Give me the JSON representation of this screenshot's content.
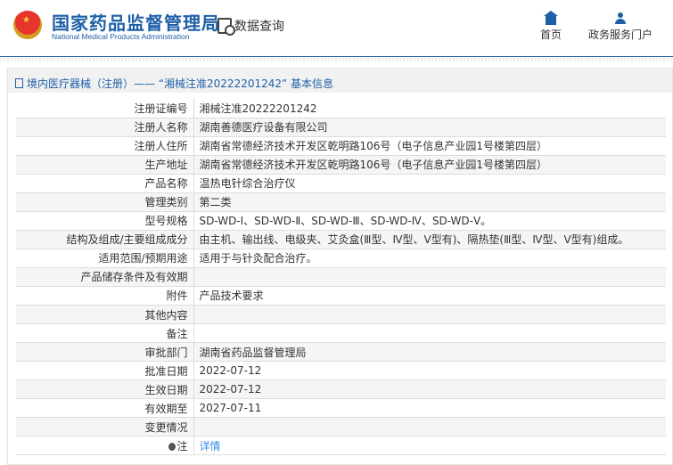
{
  "header": {
    "logo_cn": "国家药品监督管理局",
    "logo_en": "National Medical Products Administration",
    "section": "数据查询",
    "nav": [
      {
        "label": "首页",
        "icon": "home-icon"
      },
      {
        "label": "政务服务门户",
        "icon": "user-icon"
      }
    ]
  },
  "panel": {
    "title": "境内医疗器械（注册）——  “湘械注准20222201242”  基本信息"
  },
  "rows": [
    {
      "label": "注册证编号",
      "value": "湘械注准20222201242"
    },
    {
      "label": "注册人名称",
      "value": "湖南善德医疗设备有限公司"
    },
    {
      "label": "注册人住所",
      "value": "湖南省常德经济技术开发区乾明路106号（电子信息产业园1号楼第四层）"
    },
    {
      "label": "生产地址",
      "value": "湖南省常德经济技术开发区乾明路106号（电子信息产业园1号楼第四层）"
    },
    {
      "label": "产品名称",
      "value": "温热电针综合治疗仪"
    },
    {
      "label": "管理类别",
      "value": "第二类"
    },
    {
      "label": "型号规格",
      "value": "SD-WD-Ⅰ、SD-WD-Ⅱ、SD-WD-Ⅲ、SD-WD-Ⅳ、SD-WD-Ⅴ。"
    },
    {
      "label": "结构及组成/主要组成成分",
      "value": "由主机、输出线、电级夹、艾灸盒(Ⅲ型、Ⅳ型、Ⅴ型有)、隔热垫(Ⅲ型、Ⅳ型、Ⅴ型有)组成。"
    },
    {
      "label": "适用范围/预期用途",
      "value": "适用于与针灸配合治疗。"
    },
    {
      "label": "产品储存条件及有效期",
      "value": ""
    },
    {
      "label": "附件",
      "value": "产品技术要求"
    },
    {
      "label": "其他内容",
      "value": ""
    },
    {
      "label": "备注",
      "value": ""
    },
    {
      "label": "审批部门",
      "value": "湖南省药品监督管理局"
    },
    {
      "label": "批准日期",
      "value": "2022-07-12"
    },
    {
      "label": "生效日期",
      "value": "2022-07-12"
    },
    {
      "label": "有效期至",
      "value": "2027-07-11"
    },
    {
      "label": "变更情况",
      "value": ""
    },
    {
      "label": "注",
      "value": "详情"
    }
  ]
}
